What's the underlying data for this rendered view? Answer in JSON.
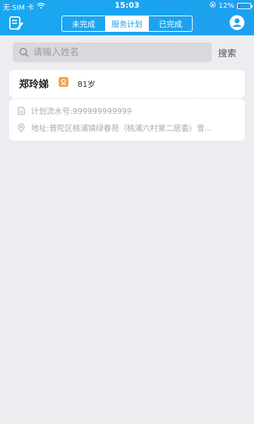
{
  "status_bar": {
    "carrier": "无 SIM 卡",
    "time": "15:03",
    "battery_pct": "12%",
    "battery_level": 0.12
  },
  "tabs": [
    {
      "label": "未完成"
    },
    {
      "label": "服务计划"
    },
    {
      "label": "已完成"
    }
  ],
  "active_tab": 1,
  "search": {
    "placeholder": "请输入姓名",
    "value": "",
    "button_label": "搜索"
  },
  "cards": [
    {
      "name": "郑玲娣",
      "age": "81岁",
      "plan_no": "计划流水号:999999999999",
      "address": "地址:普陀区桃浦镇绿春苑（桃浦六村第二居委）雪..."
    }
  ],
  "colors": {
    "header": "#1ea0ee",
    "badge": "#f3a64a",
    "background": "#ededf1"
  }
}
